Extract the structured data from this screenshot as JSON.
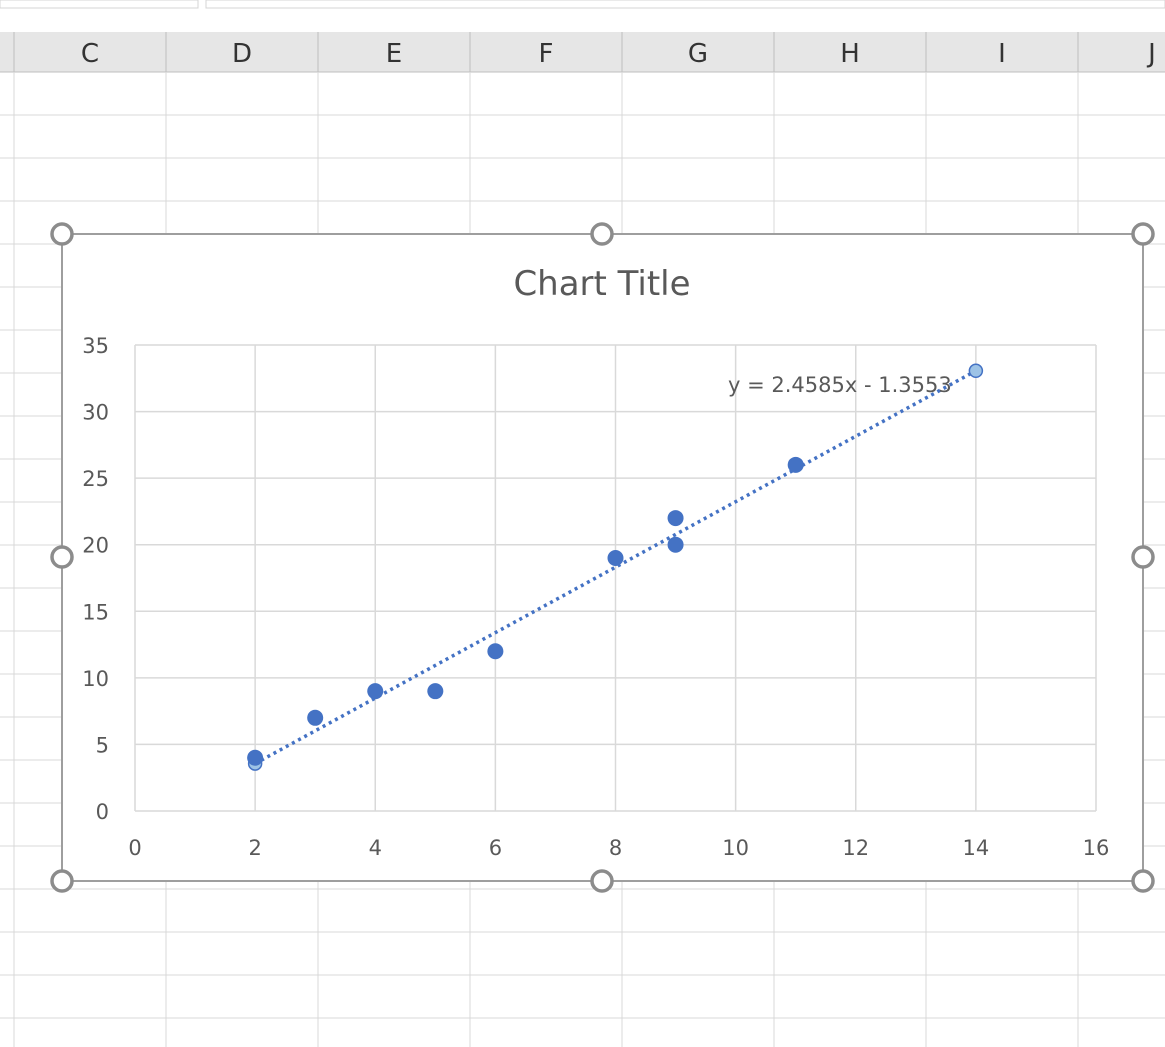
{
  "spreadsheet": {
    "column_headers": [
      "C",
      "D",
      "E",
      "F",
      "G",
      "H",
      "I",
      "J"
    ]
  },
  "chart_data": {
    "type": "scatter",
    "title": "Chart Title",
    "xlim": [
      0,
      16
    ],
    "ylim": [
      0,
      35
    ],
    "x_ticks": [
      "0",
      "2",
      "4",
      "6",
      "8",
      "10",
      "12",
      "14",
      "16"
    ],
    "y_ticks": [
      "0",
      "5",
      "10",
      "15",
      "20",
      "25",
      "30",
      "35"
    ],
    "grid": true,
    "legend": "none",
    "marker_color": "#4472C4",
    "selected_marker_color": "#9DC3E6",
    "series": [
      {
        "points": [
          {
            "x": 2,
            "y": 4
          },
          {
            "x": 3,
            "y": 7
          },
          {
            "x": 4,
            "y": 9
          },
          {
            "x": 5,
            "y": 9
          },
          {
            "x": 6,
            "y": 12
          },
          {
            "x": 8,
            "y": 19
          },
          {
            "x": 9,
            "y": 20
          },
          {
            "x": 9,
            "y": 22
          },
          {
            "x": 11,
            "y": 26
          }
        ]
      }
    ],
    "trendline": {
      "type": "linear",
      "style": "dotted",
      "slope": 2.4585,
      "intercept": -1.3553,
      "x_range": [
        2,
        14
      ],
      "equation_label": "y = 2.4585x - 1.3553"
    }
  }
}
